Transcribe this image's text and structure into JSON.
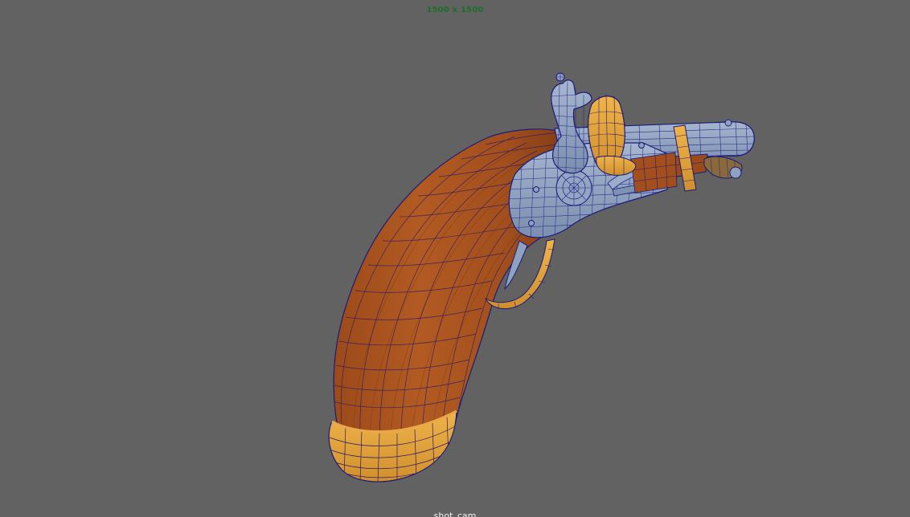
{
  "viewport": {
    "resolution_gate": "1500 x 1500",
    "camera_name": "shot_cam"
  },
  "scene": {
    "object": "flintlock-pistol",
    "display_mode": "wireframe-on-shaded",
    "colors": {
      "background": "#626262",
      "wood": "#a5521f",
      "wood_dark": "#7e3a15",
      "brass": "#e4a43c",
      "steel": "#8ea2bf",
      "wire": "#1c1a7a"
    }
  }
}
